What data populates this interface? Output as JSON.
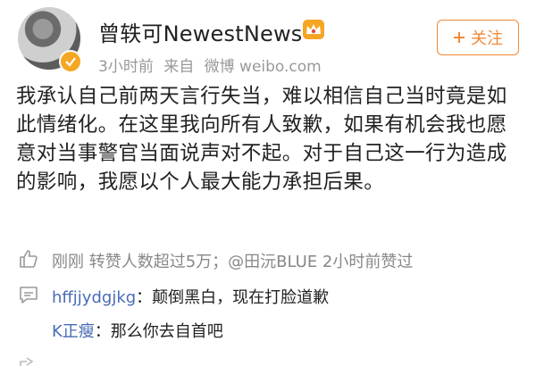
{
  "user": {
    "name": "曾轶可NewestNews",
    "time": "3小时前",
    "source_prefix": "来自",
    "source": "微博 weibo.com",
    "follow_label": "关注"
  },
  "post": {
    "text": "我承认自己前两天言行失当，难以相信自己当时竟是如此情绪化。在这里我向所有人致歉，如果有机会我也愿意对当事警官当面说声对不起。对于自己这一行为造成的影响，我愿以个人最大能力承担后果。"
  },
  "engagement": {
    "repost_text": "刚刚 转赞人数超过5万；@田沅BLUE 2小时前赞过"
  },
  "comments": [
    {
      "user": "hffjjydgjkg",
      "text": "：颠倒黑白，现在打脸道歉"
    },
    {
      "user": "K正瘦",
      "text": "：那么你去自首吧"
    }
  ],
  "colors": {
    "accent": "#f08a38",
    "link": "#4a6bb5",
    "muted": "#999999"
  }
}
